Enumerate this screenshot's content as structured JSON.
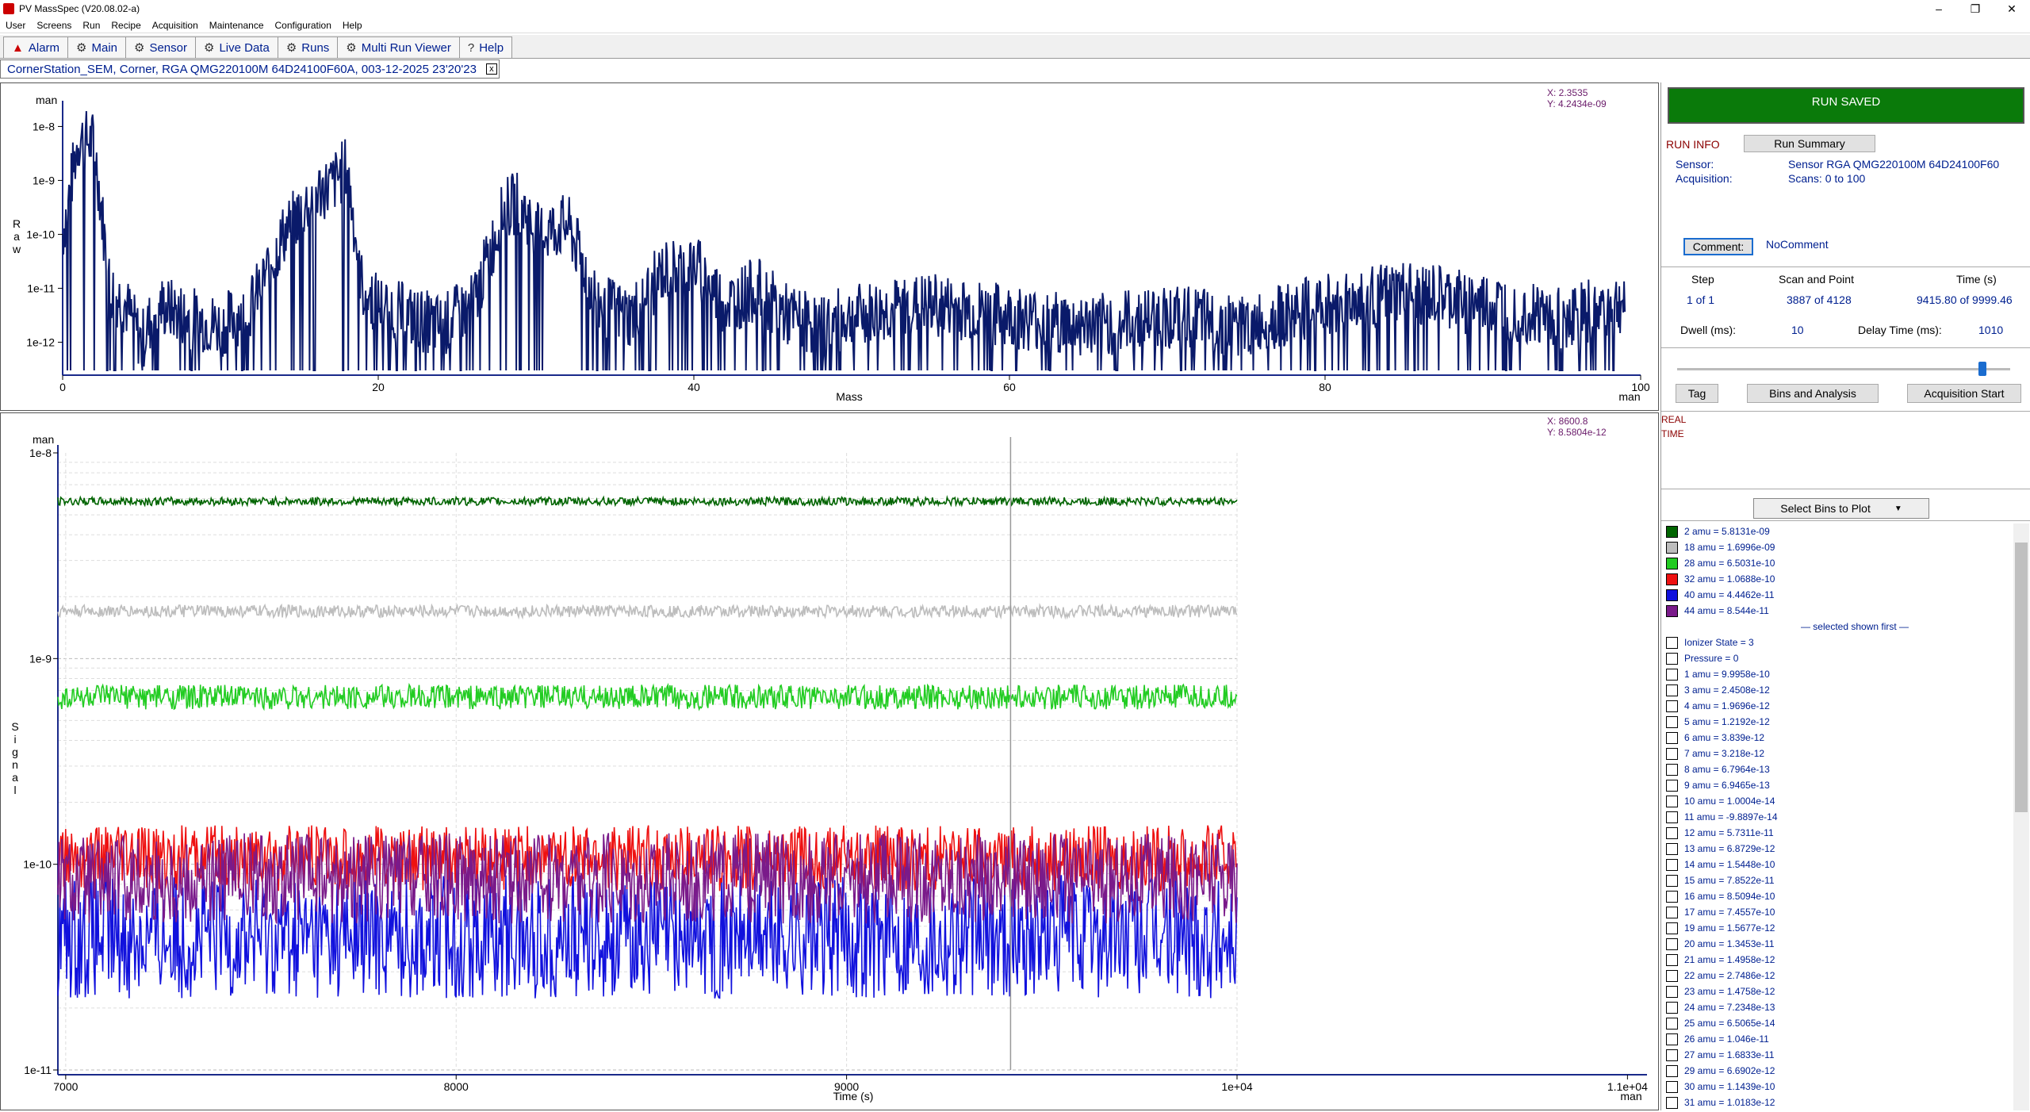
{
  "window": {
    "title": "PV MassSpec  (V20.08.02-a)",
    "minimize": "–",
    "restore": "❐",
    "close": "✕"
  },
  "menu": [
    "User",
    "Screens",
    "Run",
    "Recipe",
    "Acquisition",
    "Maintenance",
    "Configuration",
    "Help"
  ],
  "tabs": [
    {
      "label": "Alarm",
      "icon": "alarm-icon",
      "glyph": "▲"
    },
    {
      "label": "Main",
      "icon": "main-icon",
      "glyph": "⚙"
    },
    {
      "label": "Sensor",
      "icon": "sensor-icon",
      "glyph": "⚙"
    },
    {
      "label": "Live Data",
      "icon": "live-data-icon",
      "glyph": "⚙"
    },
    {
      "label": "Runs",
      "icon": "runs-icon",
      "glyph": "⚙"
    },
    {
      "label": "Multi Run Viewer",
      "icon": "multi-run-icon",
      "glyph": "⚙"
    },
    {
      "label": "Help",
      "icon": "help-icon",
      "glyph": "?"
    }
  ],
  "run_tab": {
    "label": "CornerStation_SEM, Corner, RGA QMG220100M 64D24100F60A, 003-12-2025 23'20'23",
    "close": "x"
  },
  "top_plot": {
    "cursor_x": "X: 2.3535",
    "cursor_y": "Y: 4.2434e-09",
    "unit_top": "man",
    "unit_right": "man",
    "ylabel": "Raw",
    "xlabel": "Mass",
    "yticks": [
      "1e-8",
      "1e-9",
      "1e-10",
      "1e-11",
      "1e-12"
    ],
    "xticks": [
      "0",
      "20",
      "40",
      "60",
      "80",
      "100"
    ]
  },
  "bottom_plot": {
    "cursor_x": "X: 8600.8",
    "cursor_y": "Y: 8.5804e-12",
    "unit_top": "man",
    "unit_right": "man",
    "ylabel": "Signal",
    "xlabel": "Time (s)",
    "yticks": [
      "1e-8",
      "1e-9",
      "1e-10",
      "1e-11"
    ],
    "xticks": [
      "7000",
      "8000",
      "9000",
      "1e+04",
      "1.1e+04"
    ]
  },
  "chart_data": [
    {
      "type": "line",
      "title": "",
      "xlabel": "Mass",
      "ylabel": "Raw",
      "log_y": true,
      "ylim": [
        3e-13,
        3e-08
      ],
      "xlim": [
        0,
        100
      ],
      "x": [
        0,
        1,
        2,
        3,
        4,
        5,
        6,
        8,
        10,
        12,
        14,
        16,
        17,
        18,
        19,
        20,
        22,
        24,
        26,
        28,
        29,
        30,
        32,
        34,
        36,
        38,
        40,
        42,
        44,
        46,
        48,
        50,
        55,
        60,
        65,
        70,
        75,
        80,
        85,
        90,
        95,
        99
      ],
      "series": [
        {
          "values": [
            1e-10,
            6e-09,
            5e-09,
            1e-11,
            5e-12,
            1e-12,
            5e-12,
            3e-12,
            2e-12,
            5e-12,
            1e-10,
            6e-10,
            8e-10,
            1.8e-09,
            1e-11,
            5e-12,
            3e-12,
            2e-12,
            5e-12,
            3e-10,
            4e-10,
            1e-10,
            1.5e-10,
            5e-12,
            3e-12,
            2e-11,
            3e-11,
            5e-12,
            1e-11,
            3e-12,
            2e-12,
            3e-12,
            5e-12,
            3e-12,
            2e-12,
            3e-12,
            2e-12,
            5e-12,
            8e-12,
            5e-12,
            3e-12,
            5e-12
          ]
        }
      ]
    },
    {
      "type": "line",
      "title": "",
      "xlabel": "Time (s)",
      "ylabel": "Signal",
      "log_y": true,
      "ylim": [
        1e-11,
        1e-08
      ],
      "xlim": [
        6980,
        11050
      ],
      "x": [
        6980,
        10000
      ],
      "series": [
        {
          "name": "2 amu",
          "values": [
            5.8131e-09,
            5.8131e-09
          ]
        },
        {
          "name": "18 amu",
          "values": [
            1.6996e-09,
            1.6996e-09
          ]
        },
        {
          "name": "28 amu",
          "values": [
            6.5031e-10,
            6.5031e-10
          ]
        },
        {
          "name": "32 amu",
          "values": [
            1.0688e-10,
            1.0688e-10
          ]
        },
        {
          "name": "40 amu",
          "values": [
            4.4462e-11,
            4.4462e-11
          ]
        },
        {
          "name": "44 amu",
          "values": [
            8.544e-11,
            8.544e-11
          ]
        }
      ],
      "cursor_x": 9420
    }
  ],
  "panel": {
    "run_saved": "RUN  SAVED",
    "run_info": "RUN  INFO",
    "run_summary": "Run Summary",
    "sensor_label": "Sensor:",
    "sensor_value": "Sensor RGA QMG220100M 64D24100F60",
    "acq_label": "Acquisition:",
    "acq_value": "Scans: 0 to 100",
    "comment_btn": "Comment:",
    "comment_value": "NoComment",
    "step_h": "Step",
    "scan_h": "Scan and Point",
    "time_h": "Time (s)",
    "step_v": "1 of 1",
    "scan_v": "3887 of 4128",
    "time_v": "9415.80 of 9999.46",
    "dwell_label": "Dwell (ms):",
    "dwell_v": "10",
    "delay_label": "Delay Time (ms):",
    "delay_v": "1010",
    "slider_level": 0.95,
    "tag": "Tag",
    "bins": "Bins and Analysis",
    "acq_start": "Acquisition Start",
    "real": "REAL",
    "time": "TIME",
    "select_bins": "Select Bins to Plot"
  },
  "bins": [
    {
      "text": "2 amu = 5.8131e-09",
      "color": "#006400"
    },
    {
      "text": "18 amu = 1.6996e-09",
      "color": "#bdbdbd"
    },
    {
      "text": "28 amu = 6.5031e-10",
      "color": "#22cc22"
    },
    {
      "text": "32 amu = 1.0688e-10",
      "color": "#ee1111"
    },
    {
      "text": "40 amu = 4.4462e-11",
      "color": "#1111dd"
    },
    {
      "text": "44 amu = 8.544e-11",
      "color": "#7a1a8a"
    },
    {
      "text": "— selected shown first —",
      "color": ""
    },
    {
      "text": "Ionizer State = 3",
      "color": "#fff"
    },
    {
      "text": "Pressure = 0",
      "color": "#fff"
    },
    {
      "text": "1 amu = 9.9958e-10",
      "color": "#fff"
    },
    {
      "text": "3 amu = 2.4508e-12",
      "color": "#fff"
    },
    {
      "text": "4 amu = 1.9696e-12",
      "color": "#fff"
    },
    {
      "text": "5 amu = 1.2192e-12",
      "color": "#fff"
    },
    {
      "text": "6 amu = 3.839e-12",
      "color": "#fff"
    },
    {
      "text": "7 amu = 3.218e-12",
      "color": "#fff"
    },
    {
      "text": "8 amu = 6.7964e-13",
      "color": "#fff"
    },
    {
      "text": "9 amu = 6.9465e-13",
      "color": "#fff"
    },
    {
      "text": "10 amu = 1.0004e-14",
      "color": "#fff"
    },
    {
      "text": "11 amu = -9.8897e-14",
      "color": "#fff"
    },
    {
      "text": "12 amu = 5.7311e-11",
      "color": "#fff"
    },
    {
      "text": "13 amu = 6.8729e-12",
      "color": "#fff"
    },
    {
      "text": "14 amu = 1.5448e-10",
      "color": "#fff"
    },
    {
      "text": "15 amu = 7.8522e-11",
      "color": "#fff"
    },
    {
      "text": "16 amu = 8.5094e-10",
      "color": "#fff"
    },
    {
      "text": "17 amu = 7.4557e-10",
      "color": "#fff"
    },
    {
      "text": "19 amu = 1.5677e-12",
      "color": "#fff"
    },
    {
      "text": "20 amu = 1.3453e-11",
      "color": "#fff"
    },
    {
      "text": "21 amu = 1.4958e-12",
      "color": "#fff"
    },
    {
      "text": "22 amu = 2.7486e-12",
      "color": "#fff"
    },
    {
      "text": "23 amu = 1.4758e-12",
      "color": "#fff"
    },
    {
      "text": "24 amu = 7.2348e-13",
      "color": "#fff"
    },
    {
      "text": "25 amu = 6.5065e-14",
      "color": "#fff"
    },
    {
      "text": "26 amu = 1.046e-11",
      "color": "#fff"
    },
    {
      "text": "27 amu = 1.6833e-11",
      "color": "#fff"
    },
    {
      "text": "29 amu = 6.6902e-12",
      "color": "#fff"
    },
    {
      "text": "30 amu = 1.1439e-10",
      "color": "#fff"
    },
    {
      "text": "31 amu = 1.0183e-12",
      "color": "#fff"
    }
  ]
}
